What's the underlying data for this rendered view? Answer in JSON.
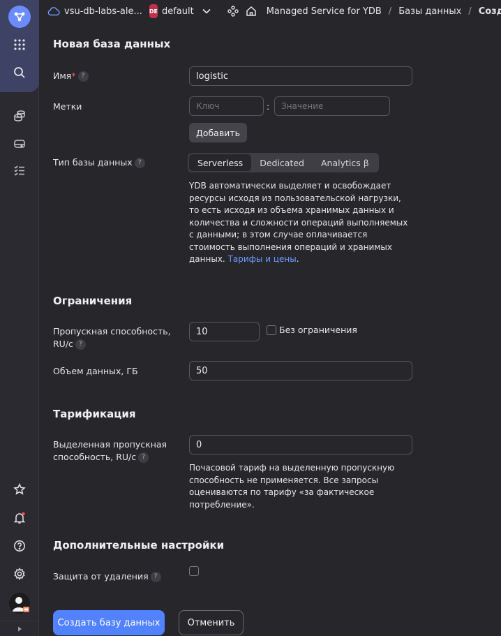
{
  "header": {
    "cloud_name": "vsu-db-labs-ale...",
    "folder_badge": "DE",
    "folder_name": "default",
    "breadcrumbs": [
      "Managed Service for YDB",
      "Базы данных",
      "Создать"
    ]
  },
  "sidebar": {
    "icons": [
      "app-logo-icon",
      "apps-grid-icon",
      "search-icon",
      "databases-icon",
      "storage-icon",
      "task-list-icon",
      "star-icon",
      "notifications-bell-icon",
      "help-icon",
      "settings-gear-icon",
      "user-avatar",
      "collapse-arrow-icon"
    ]
  },
  "form": {
    "title": "Новая база данных",
    "name_label": "Имя",
    "name_required_mark": "*",
    "name_value": "logistic",
    "labels_label": "Метки",
    "key_placeholder": "Ключ",
    "value_placeholder": "Значение",
    "colon": ":",
    "add_button": "Добавить",
    "db_type_label": "Тип базы данных",
    "db_types": [
      "Serverless",
      "Dedicated",
      "Analytics β"
    ],
    "db_type_selected": "Serverless",
    "description": "YDB автоматически выделяет и освобождает ресурсы исходя из пользовательской нагрузки, то есть исходя из объема хранимых данных и количества и сложности операций выполняемых с данными; в этом случае оплачивается стоимость выполнения операций и хранимых данных.",
    "pricing_link": "Тарифы и цены",
    "period": "."
  },
  "limits": {
    "title": "Ограничения",
    "throughput_label_1": "Пропускная способность,",
    "throughput_label_2": "RU/с",
    "throughput_value": "10",
    "no_limit_label": "Без ограничения",
    "no_limit_checked": false,
    "storage_label": "Объем данных, ГБ",
    "storage_value": "50"
  },
  "billing": {
    "title": "Тарификация",
    "provisioned_label_1": "Выделенная пропускная",
    "provisioned_label_2": "способность, RU/с",
    "provisioned_value": "0",
    "note": "Почасовой тариф на выделенную пропускную способность не применяется. Все запросы оцениваются по тарифу «за фактическое потребление»."
  },
  "extra": {
    "title": "Дополнительные настройки",
    "deletion_protection_label": "Защита от удаления",
    "deletion_protection_checked": false
  },
  "actions": {
    "create": "Создать базу данных",
    "cancel": "Отменить"
  },
  "colors": {
    "background": "#27262b",
    "accent": "#5282ff",
    "link": "#6d9bff",
    "badge": "#c0304a"
  }
}
